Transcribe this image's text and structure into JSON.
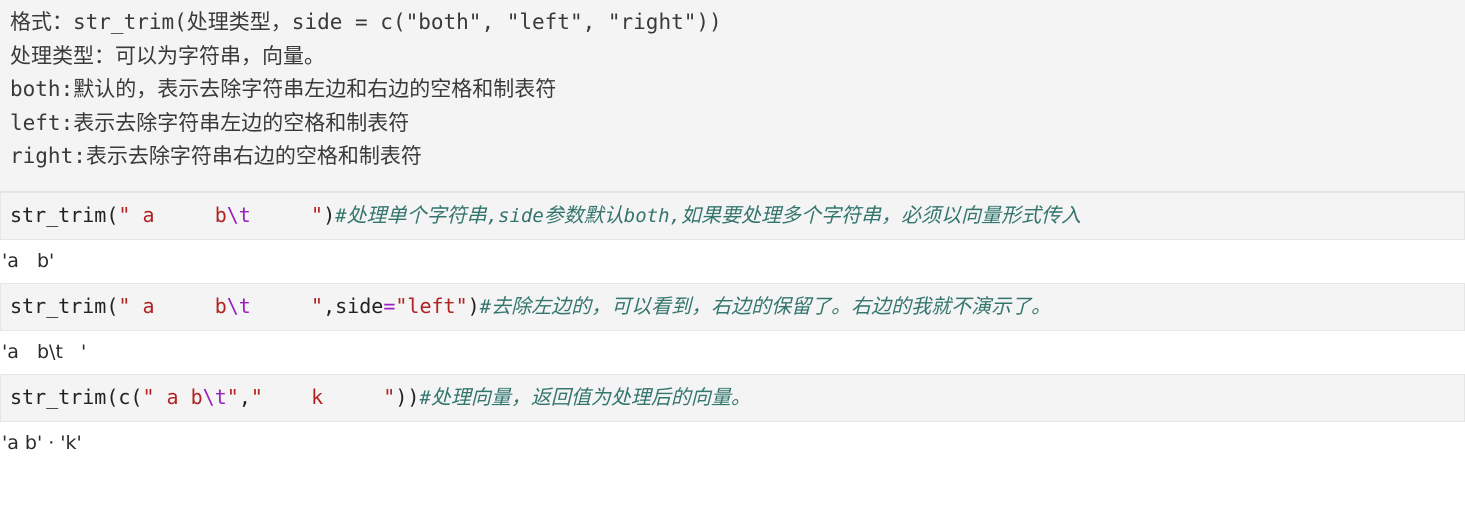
{
  "doc": {
    "lines": [
      {
        "id": "format-line",
        "segments": [
          {
            "type": "cjk",
            "text": "格式："
          },
          {
            "type": "mono",
            "text": "str_trim("
          },
          {
            "type": "cjk",
            "text": "处理类型，"
          },
          {
            "type": "mono",
            "text": "side = c(\"both\", \"left\", \"right\"))"
          }
        ]
      },
      {
        "id": "param-line",
        "segments": [
          {
            "type": "cjk",
            "text": "处理类型：可以为字符串，向量。"
          }
        ]
      },
      {
        "id": "both-line",
        "segments": [
          {
            "type": "mono",
            "text": "both:"
          },
          {
            "type": "cjk",
            "text": "默认的，表示去除字符串左边和右边的空格和制表符"
          }
        ]
      },
      {
        "id": "left-line",
        "segments": [
          {
            "type": "mono",
            "text": "left:"
          },
          {
            "type": "cjk",
            "text": "表示去除字符串左边的空格和制表符"
          }
        ]
      },
      {
        "id": "right-line",
        "segments": [
          {
            "type": "mono",
            "text": "right:"
          },
          {
            "type": "cjk",
            "text": "表示去除字符串右边的空格和制表符"
          }
        ]
      }
    ]
  },
  "cells": [
    {
      "id": "cell-1",
      "code_tokens": [
        {
          "cls": "tok-plain",
          "text": "str_trim("
        },
        {
          "cls": "tok-str",
          "text": "\" a     b"
        },
        {
          "cls": "tok-esc",
          "text": "\\t"
        },
        {
          "cls": "tok-str",
          "text": "     \""
        },
        {
          "cls": "tok-plain",
          "text": ")"
        },
        {
          "cls": "tok-comment",
          "text": "#处理单个字符串,side参数默认both,如果要处理多个字符串，必须以向量形式传入"
        }
      ],
      "output": "'a   b'"
    },
    {
      "id": "cell-2",
      "code_tokens": [
        {
          "cls": "tok-plain",
          "text": "str_trim("
        },
        {
          "cls": "tok-str",
          "text": "\" a     b"
        },
        {
          "cls": "tok-esc",
          "text": "\\t"
        },
        {
          "cls": "tok-str",
          "text": "     \""
        },
        {
          "cls": "tok-plain",
          "text": ",side"
        },
        {
          "cls": "tok-op",
          "text": "="
        },
        {
          "cls": "tok-str",
          "text": "\"left\""
        },
        {
          "cls": "tok-plain",
          "text": ")"
        },
        {
          "cls": "tok-comment",
          "text": "#去除左边的，可以看到，右边的保留了。右边的我就不演示了。"
        }
      ],
      "output": "'a   b\\t   '"
    },
    {
      "id": "cell-3",
      "code_tokens": [
        {
          "cls": "tok-plain",
          "text": "str_trim(c("
        },
        {
          "cls": "tok-str",
          "text": "\" a b"
        },
        {
          "cls": "tok-esc",
          "text": "\\t"
        },
        {
          "cls": "tok-str",
          "text": "\""
        },
        {
          "cls": "tok-plain",
          "text": ","
        },
        {
          "cls": "tok-str",
          "text": "\"    k     \""
        },
        {
          "cls": "tok-plain",
          "text": "))"
        },
        {
          "cls": "tok-comment",
          "text": "#处理向量，返回值为处理后的向量。"
        }
      ],
      "output": "'a b' · 'k'"
    }
  ],
  "colors": {
    "cell_background": "#f4f4f4",
    "cell_border": "#e6e6e6",
    "string_token": "#b22222",
    "escape_token": "#9b1fbf",
    "operator_token": "#9b1fbf",
    "comment_token": "#34756e",
    "body_text": "#3a3a3a",
    "page_background": "#ffffff"
  }
}
